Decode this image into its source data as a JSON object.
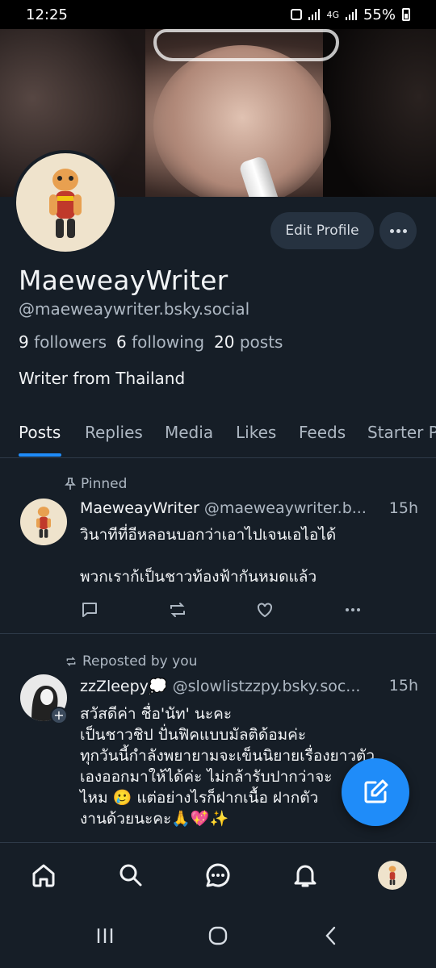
{
  "status_bar": {
    "time": "12:25",
    "network": "4G",
    "battery": "55%"
  },
  "profile": {
    "edit_label": "Edit Profile",
    "display_name": "MaeweayWriter",
    "handle": "@maeweaywriter.bsky.social",
    "followers_count": "9",
    "followers_label": "followers",
    "following_count": "6",
    "following_label": "following",
    "posts_count": "20",
    "posts_label": "posts",
    "bio": "Writer from Thailand"
  },
  "tabs": [
    "Posts",
    "Replies",
    "Media",
    "Likes",
    "Feeds",
    "Starter P"
  ],
  "active_tab": "Posts",
  "posts": [
    {
      "context": "Pinned",
      "author": "MaeweayWriter",
      "handle": "@maeweaywriter.b...",
      "time": "15h",
      "line1": "วินาทีที่อีหลอนบอกว่าเอาไปเจนเอไอได้",
      "line2": "พวกเราก้เป็นชาวท้องฟ้ากันหมดแล้ว"
    },
    {
      "context": "Reposted by you",
      "author": "zzZleepy💭",
      "handle": "@slowlistzzpy.bsky.soc...",
      "time": "15h",
      "line1": "สวัสดีค่า ชื่อ'นัท' นะคะ",
      "line2": "เป็นชาวชิป ปั่นฟิคแบบมัลติด้อมค่ะ",
      "line3": "ทุกวันนี้กำลังพยายามจะเข็นนิยายเรื่องยาวตัว",
      "line4": "เองออกมาให้ได้ค่ะ ไม่กล้ารับปากว่าจะ",
      "line5": "ไหม 🥲 แต่อย่างไรก็ฝากเนื้อ ฝากตัว",
      "line6": "งานด้วยนะคะ🙏💖✨"
    }
  ],
  "colors": {
    "background": "#161e27",
    "accent": "#1f8cf9",
    "button": "#263240"
  }
}
